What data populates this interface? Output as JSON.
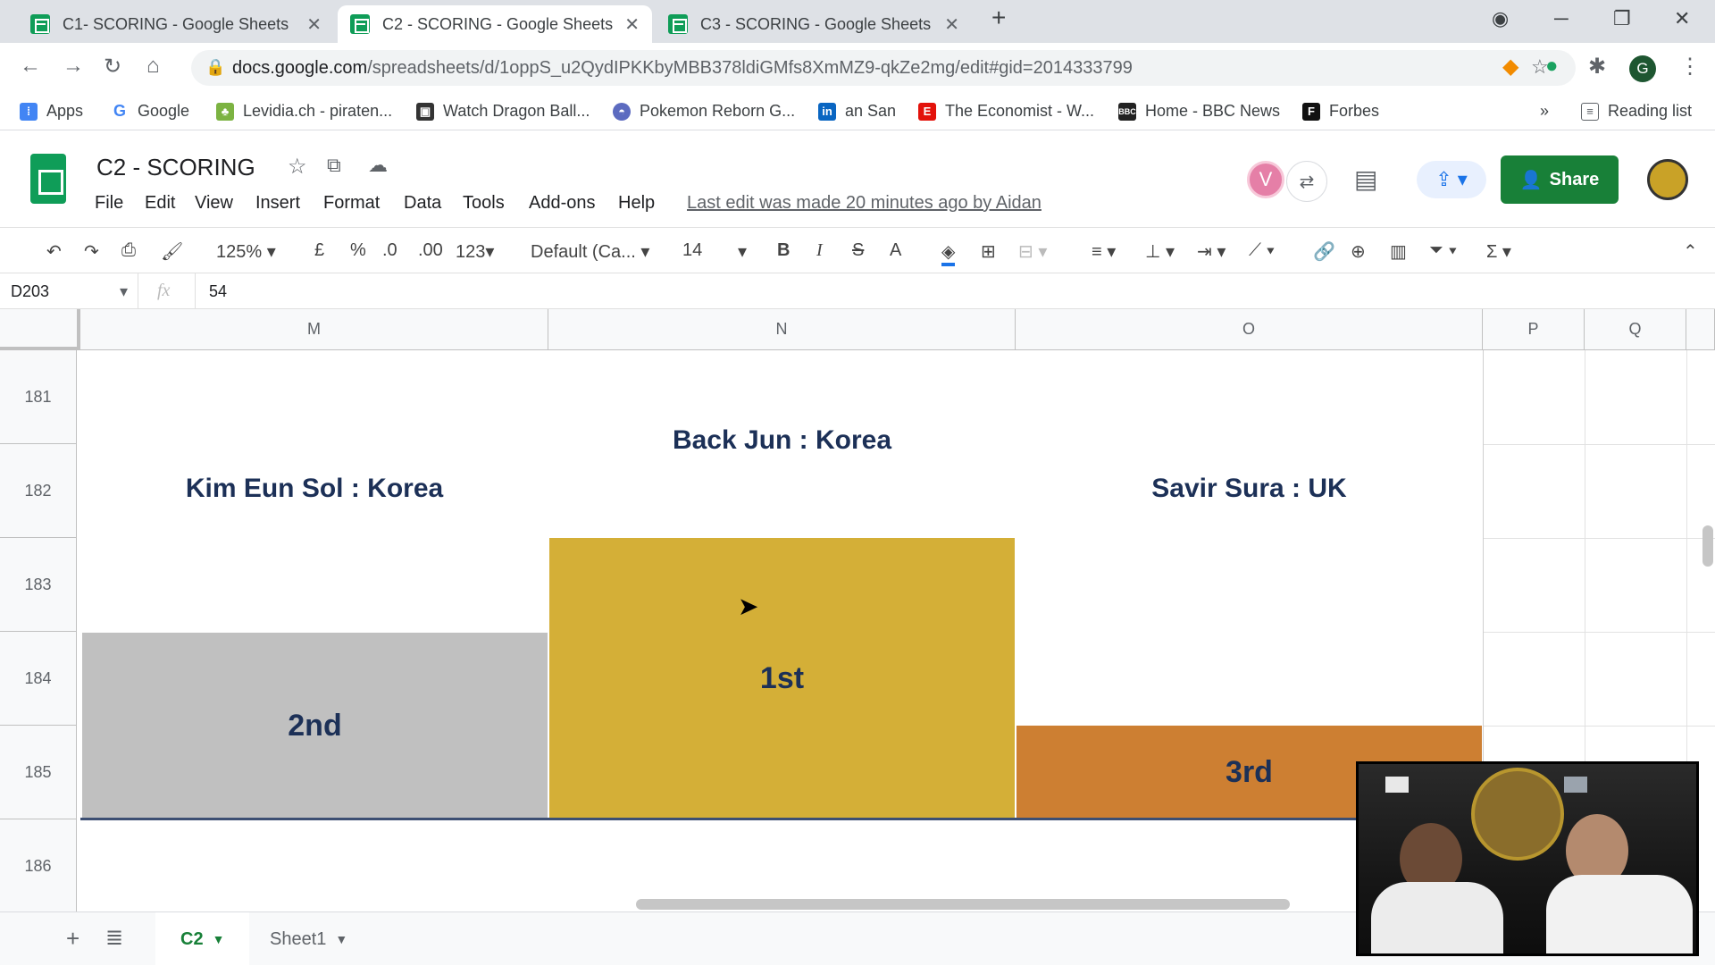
{
  "browser": {
    "tabs": [
      {
        "title": "C1- SCORING - Google Sheets",
        "active": false
      },
      {
        "title": "C2 - SCORING - Google Sheets",
        "active": true
      },
      {
        "title": "C3 - SCORING - Google Sheets",
        "active": false
      }
    ],
    "new_tab": "+",
    "url_host": "docs.google.com",
    "url_path": "/spreadsheets/d/1oppS_u2QydIPKKbyMBB378ldiGMfs8XmMZ9-qkZe2mg/edit#gid=2014333799",
    "profile_initial": "G"
  },
  "bookmarks": [
    {
      "label": "Apps",
      "icon": "apps-grid-icon",
      "color": "#4285f4"
    },
    {
      "label": "Google",
      "icon": "google-icon",
      "color": "#4285f4"
    },
    {
      "label": "Levidia.ch - piraten...",
      "icon": "leaf-icon",
      "color": "#7cb342"
    },
    {
      "label": "Watch Dragon Ball...",
      "icon": "tv-icon",
      "color": "#333333"
    },
    {
      "label": "Pokemon Reborn G...",
      "icon": "pokeball-icon",
      "color": "#5c6bc0"
    },
    {
      "label": "an San",
      "icon": "linkedin-icon",
      "color": "#0a66c2"
    },
    {
      "label": "The Economist - W...",
      "icon": "economist-icon",
      "color": "#e3120b"
    },
    {
      "label": "Home - BBC News",
      "icon": "bbc-icon",
      "color": "#222222"
    },
    {
      "label": "Forbes",
      "icon": "forbes-icon",
      "color": "#111111"
    }
  ],
  "bookmarks_overflow": "»",
  "reading_list": "Reading list",
  "sheets": {
    "doc_title": "C2 - SCORING",
    "menu": [
      "File",
      "Edit",
      "View",
      "Insert",
      "Format",
      "Data",
      "Tools",
      "Add-ons",
      "Help"
    ],
    "last_edit": "Last edit was made 20 minutes ago by Aidan",
    "share_label": "Share",
    "avatar_initial": "V"
  },
  "format_toolbar": {
    "zoom": "125%",
    "currency": "£",
    "percent": "%",
    "dec_decrease": ".0",
    "dec_increase": ".00",
    "more_formats": "123",
    "font": "Default (Ca...",
    "font_size": "14",
    "bold": "B",
    "italic": "I",
    "strike": "S",
    "text_color": "A",
    "sum": "Σ"
  },
  "formula_bar": {
    "cell_ref": "D203",
    "fx": "fx",
    "value": "54"
  },
  "grid": {
    "columns": [
      "M",
      "N",
      "O",
      "P",
      "Q"
    ],
    "rows": [
      "181",
      "182",
      "183",
      "184",
      "185",
      "186"
    ]
  },
  "podium": {
    "first": {
      "name": "Back Jun : Korea",
      "place": "1st",
      "color": "#d4af37"
    },
    "second": {
      "name": "Kim  Eun Sol : Korea",
      "place": "2nd",
      "color": "#c0c0c0"
    },
    "third": {
      "name": "Savir Sura : UK",
      "place": "3rd",
      "color": "#cd7f32"
    }
  },
  "sheet_tabs": [
    {
      "label": "C2",
      "active": true
    },
    {
      "label": "Sheet1",
      "active": false
    }
  ]
}
